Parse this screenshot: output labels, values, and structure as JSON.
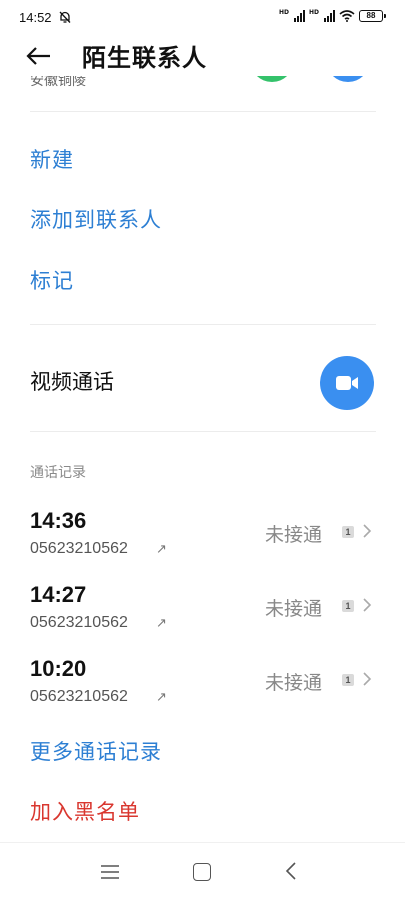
{
  "status_bar": {
    "time": "14:52",
    "battery": "88"
  },
  "header": {
    "title": "陌生联系人"
  },
  "partial_row": {
    "text": "安徽铜陵"
  },
  "actions": [
    {
      "label": "新建"
    },
    {
      "label": "添加到联系人"
    },
    {
      "label": "标记"
    }
  ],
  "video_call": {
    "label": "视频通话"
  },
  "call_log": {
    "title": "通话记录",
    "records": [
      {
        "time": "14:36",
        "number": "05623210562",
        "arrow": "↗",
        "status": "未接通",
        "count": "1"
      },
      {
        "time": "14:27",
        "number": "05623210562",
        "arrow": "↗",
        "status": "未接通",
        "count": "1"
      },
      {
        "time": "10:20",
        "number": "05623210562",
        "arrow": "↗",
        "status": "未接通",
        "count": "1"
      }
    ]
  },
  "more_records": "更多通话记录",
  "block": "加入黑名单",
  "colors": {
    "link": "#2d7fd3",
    "danger": "#d9372f",
    "video_button": "#3a8ff0",
    "green": "#34c26b"
  },
  "icons": {
    "back": "back-arrow-icon",
    "bell_off": "bell-off-icon",
    "video": "video-camera-icon",
    "chevron": "chevron-right-icon"
  }
}
